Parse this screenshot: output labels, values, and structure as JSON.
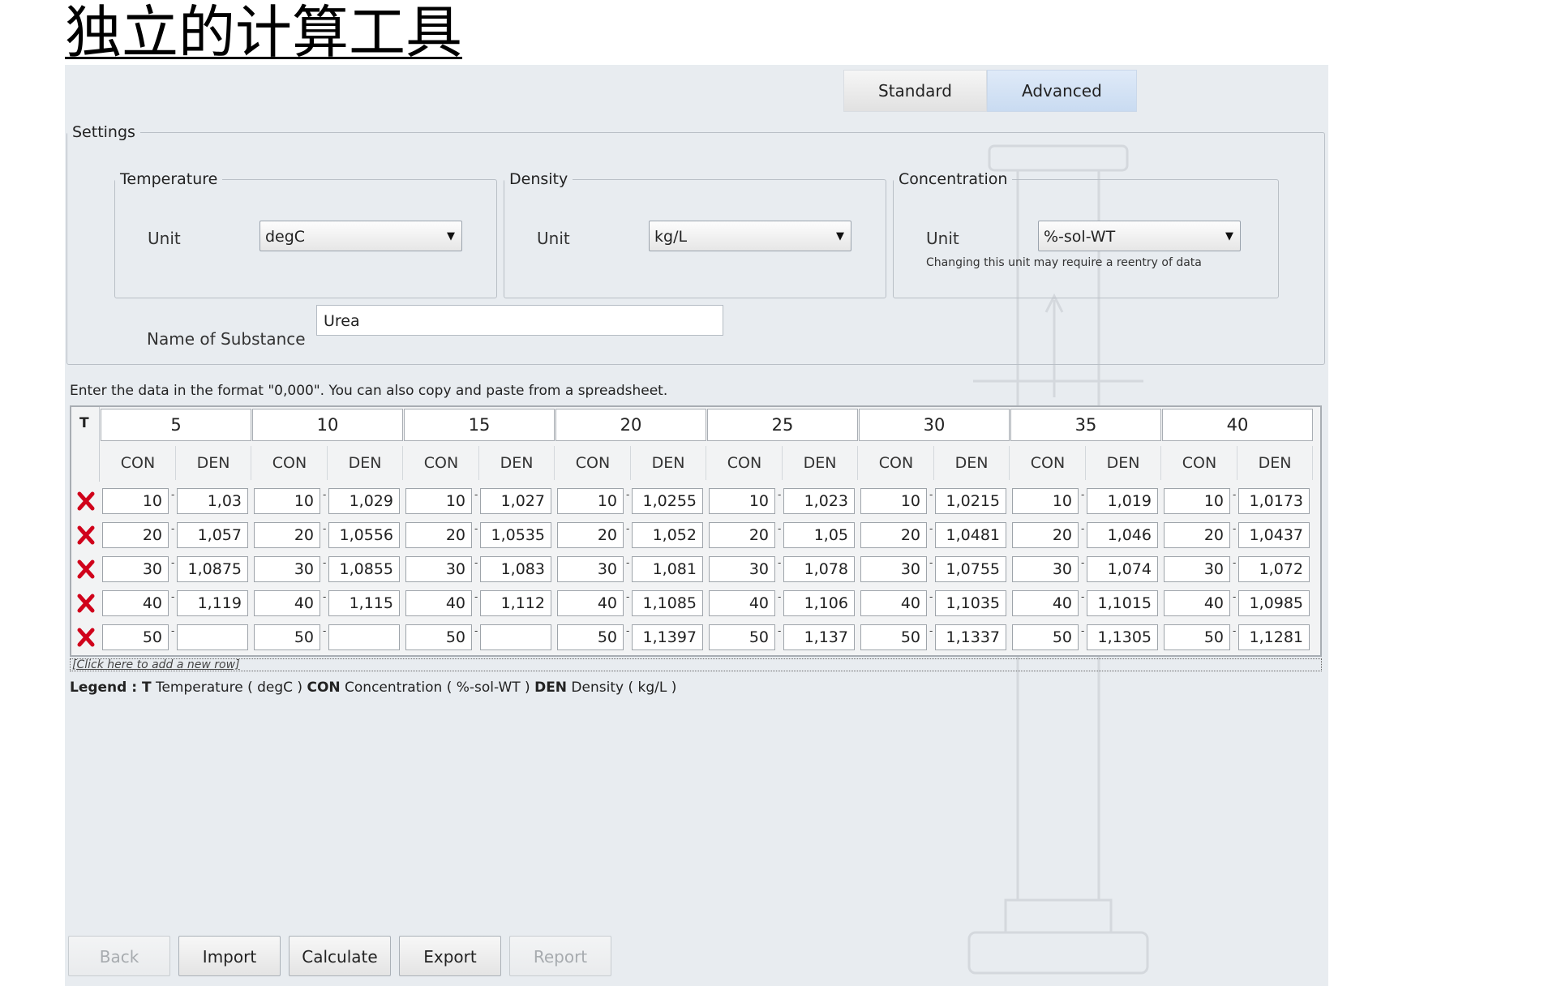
{
  "document": {
    "title": "独立的计算工具"
  },
  "mode_switch": {
    "standard": "Standard",
    "advanced": "Advanced"
  },
  "settings": {
    "legend": "Settings",
    "temperature": {
      "legend": "Temperature",
      "unit_label": "Unit",
      "unit_value": "degC"
    },
    "density": {
      "legend": "Density",
      "unit_label": "Unit",
      "unit_value": "kg/L"
    },
    "concentration": {
      "legend": "Concentration",
      "unit_label": "Unit",
      "unit_value": "%-sol-WT",
      "hint": "Changing this unit may require a reentry of data"
    },
    "substance": {
      "label": "Name of Substance",
      "value": "Urea"
    }
  },
  "instruction": "Enter the data in the format \"0,000\". You can also copy and paste from a spreadsheet.",
  "table": {
    "corner_label": "T",
    "con_header": "CON",
    "den_header": "DEN",
    "temperatures": [
      "5",
      "10",
      "15",
      "20",
      "25",
      "30",
      "35",
      "40"
    ],
    "rows": [
      {
        "con": "10",
        "den": [
          "1,03",
          "1,029",
          "1,027",
          "1,0255",
          "1,023",
          "1,0215",
          "1,019",
          "1,0173"
        ]
      },
      {
        "con": "20",
        "den": [
          "1,057",
          "1,0556",
          "1,0535",
          "1,052",
          "1,05",
          "1,0481",
          "1,046",
          "1,0437"
        ]
      },
      {
        "con": "30",
        "den": [
          "1,0875",
          "1,0855",
          "1,083",
          "1,081",
          "1,078",
          "1,0755",
          "1,074",
          "1,072"
        ]
      },
      {
        "con": "40",
        "den": [
          "1,119",
          "1,115",
          "1,112",
          "1,1085",
          "1,106",
          "1,1035",
          "1,1015",
          "1,0985"
        ]
      },
      {
        "con": "50",
        "den": [
          "",
          "",
          "",
          "1,1397",
          "1,137",
          "1,1337",
          "1,1305",
          "1,1281"
        ]
      }
    ],
    "add_row": "[Click here to add a new row]"
  },
  "legend_line": {
    "prefix": "Legend : ",
    "t_key": "T",
    "t_text": " Temperature ( degC ) ",
    "con_key": "CON",
    "con_text": " Concentration ( %-sol-WT ) ",
    "den_key": "DEN",
    "den_text": " Density ( kg/L )"
  },
  "buttons": {
    "back": "Back",
    "import": "Import",
    "calculate": "Calculate",
    "export": "Export",
    "report": "Report"
  },
  "icons": {
    "delete": "delete-row-icon",
    "dropdown": "chevron-down-icon"
  },
  "colors": {
    "delete_red": "#d0021b",
    "active_tab": "#cfdef2",
    "background": "#e8ecf0"
  }
}
